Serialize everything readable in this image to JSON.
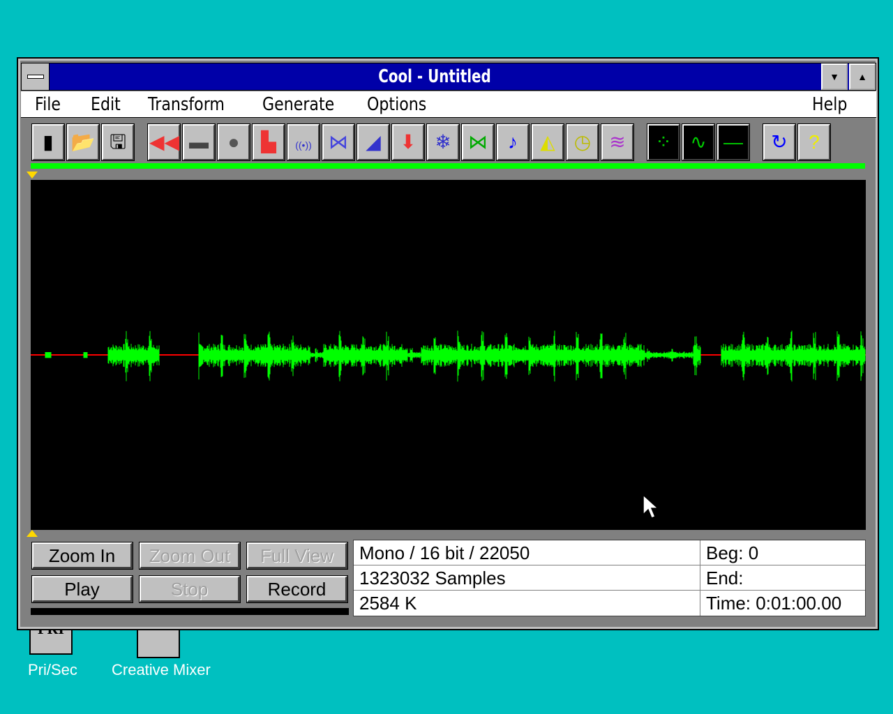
{
  "window": {
    "title": "Cool - Untitled"
  },
  "menu": [
    "File",
    "Edit",
    "Transform",
    "Generate",
    "Options",
    "Help"
  ],
  "toolbar": {
    "file_tools": [
      "new-icon",
      "open-icon",
      "save-icon"
    ],
    "effect_tools": [
      "reverse-icon",
      "silence-icon",
      "noise-icon",
      "amplify-icon",
      "echo-icon",
      "flanger-icon",
      "envelope-icon",
      "invert-icon",
      "freeze-icon",
      "compress-icon",
      "music-note-icon",
      "fade-icon",
      "stopwatch-icon",
      "filter-icon"
    ],
    "generate_tools": [
      "generate-noise-icon",
      "generate-tone-icon",
      "generate-silence-icon"
    ],
    "misc_tools": [
      "loop-icon",
      "help-icon"
    ]
  },
  "buttons": {
    "zoom_in": "Zoom In",
    "zoom_out": "Zoom Out",
    "full_view": "Full View",
    "play": "Play",
    "stop": "Stop",
    "record": "Record"
  },
  "info": {
    "format": "Mono / 16 bit / 22050",
    "samples": "1323032 Samples",
    "size": "2584 K",
    "beg": "Beg: 0",
    "end": "End:",
    "time": "Time: 0:01:00.00"
  },
  "desktop": {
    "icons": [
      {
        "label": "Pri/Sec",
        "glyph": "PRI"
      },
      {
        "label": "Creative Mixer"
      }
    ]
  },
  "colors": {
    "waveform": "#00ff00",
    "centerline": "#ff0000",
    "titlebar": "#0000a8",
    "desktop": "#00c0c0"
  }
}
